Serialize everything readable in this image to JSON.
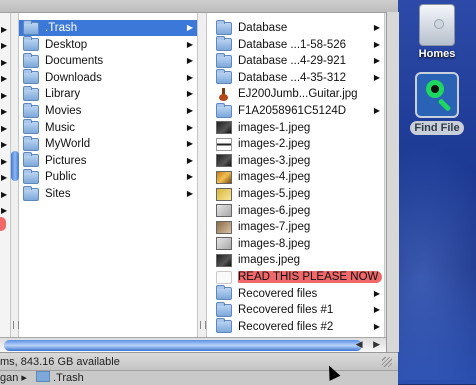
{
  "desktop": {
    "icons": [
      {
        "label": "Homes",
        "icon": "hard-drive-icon"
      },
      {
        "label": "Find File",
        "icon": "find-file-app-icon"
      }
    ]
  },
  "column1": {
    "items": [
      {
        "label": ".Trash",
        "icon": "folder-icon",
        "selected": true,
        "has_children": true
      },
      {
        "label": "Desktop",
        "icon": "folder-icon",
        "has_children": true
      },
      {
        "label": "Documents",
        "icon": "folder-icon",
        "has_children": true
      },
      {
        "label": "Downloads",
        "icon": "folder-icon",
        "has_children": true
      },
      {
        "label": "Library",
        "icon": "folder-icon",
        "has_children": true
      },
      {
        "label": "Movies",
        "icon": "folder-icon",
        "has_children": true
      },
      {
        "label": "Music",
        "icon": "folder-icon",
        "has_children": true
      },
      {
        "label": "MyWorld",
        "icon": "folder-icon",
        "has_children": true
      },
      {
        "label": "Pictures",
        "icon": "folder-icon",
        "has_children": true
      },
      {
        "label": "Public",
        "icon": "folder-icon",
        "has_children": true
      },
      {
        "label": "Sites",
        "icon": "folder-icon",
        "has_children": true
      }
    ]
  },
  "column2": {
    "items": [
      {
        "label": "Database",
        "icon": "folder-icon",
        "has_children": true
      },
      {
        "label": "Database ...1-58-526",
        "icon": "folder-icon",
        "has_children": true
      },
      {
        "label": "Database ...4-29-921",
        "icon": "folder-icon",
        "has_children": true
      },
      {
        "label": "Database ...4-35-312",
        "icon": "folder-icon",
        "has_children": true
      },
      {
        "label": "EJ200Jumb...Guitar.jpg",
        "icon": "guitar-image-icon",
        "has_children": false
      },
      {
        "label": "F1A2058961C5124D",
        "icon": "folder-icon",
        "has_children": true
      },
      {
        "label": "images-1.jpeg",
        "icon": "image-file-icon",
        "has_children": false
      },
      {
        "label": "images-2.jpeg",
        "icon": "image-file-icon",
        "has_children": false
      },
      {
        "label": "images-3.jpeg",
        "icon": "image-file-icon",
        "has_children": false
      },
      {
        "label": "images-4.jpeg",
        "icon": "image-file-icon",
        "has_children": false
      },
      {
        "label": "images-5.jpeg",
        "icon": "image-file-icon",
        "has_children": false
      },
      {
        "label": "images-6.jpeg",
        "icon": "image-file-icon",
        "has_children": false
      },
      {
        "label": "images-7.jpeg",
        "icon": "image-file-icon",
        "has_children": false
      },
      {
        "label": "images-8.jpeg",
        "icon": "image-file-icon",
        "has_children": false
      },
      {
        "label": "images.jpeg",
        "icon": "image-file-icon",
        "has_children": false
      },
      {
        "label": "READ THIS PLEASE NOW",
        "icon": "text-document-icon",
        "has_children": false,
        "label_color": "#f0686a"
      },
      {
        "label": "Recovered files",
        "icon": "folder-icon",
        "has_children": true
      },
      {
        "label": "Recovered files #1",
        "icon": "folder-icon",
        "has_children": true
      },
      {
        "label": "Recovered files #2",
        "icon": "folder-icon",
        "has_children": true
      }
    ]
  },
  "status": {
    "text": "ms, 843.16 GB available"
  },
  "pathbar": {
    "prefix": "gan",
    "separator": "▸",
    "current": ".Trash"
  },
  "scroll_arrows": "◀ ▶",
  "colors": {
    "selection": "#3b78d8",
    "label_red": "#f0686a",
    "desktop_blue": "#1d3a95"
  }
}
